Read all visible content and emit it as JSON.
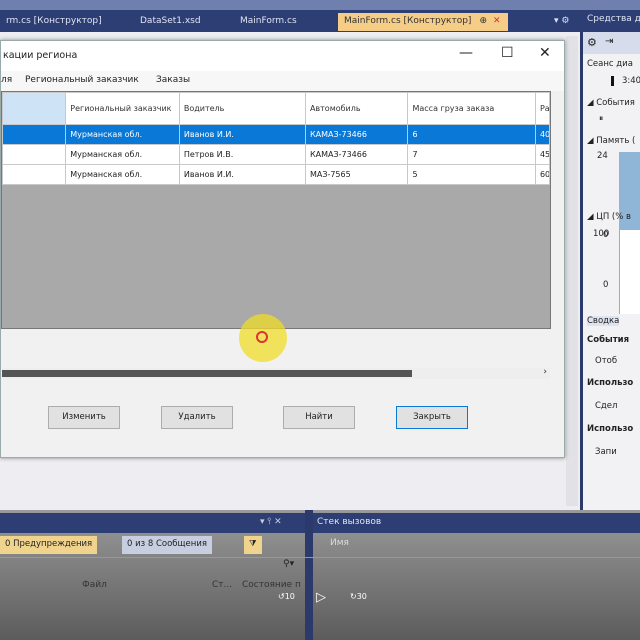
{
  "tabs": [
    {
      "label": "rm.cs [Конструктор]"
    },
    {
      "label": "DataSet1.xsd"
    },
    {
      "label": "MainForm.cs"
    },
    {
      "label": "MainForm.cs [Конструктор]",
      "active": true
    }
  ],
  "form": {
    "title": "кации региона",
    "menu": [
      "ля",
      "Региональный заказчик",
      "Заказы"
    ],
    "columns": [
      "",
      "Региональный заказчик",
      "Водитель",
      "Автомобиль",
      "Масса груза заказа",
      "Ра да"
    ],
    "rows": [
      [
        "",
        "Мурманская обл.",
        "Иванов И.И.",
        "КАМАЗ-73466",
        "6",
        "40"
      ],
      [
        "",
        "Мурманская обл.",
        "Петров И.В.",
        "КАМАЗ-73466",
        "7",
        "45"
      ],
      [
        "",
        "Мурманская обл.",
        "Иванов И.И.",
        "МАЗ-7565",
        "5",
        "60"
      ]
    ],
    "buttons": {
      "edit": "Изменить",
      "delete": "Удалить",
      "find": "Найти",
      "close": "Закрыть"
    }
  },
  "diagnostics": {
    "title": "Средства д",
    "session": "Сеанс диа",
    "time": "3:40",
    "events": "◢ События",
    "memory": "◢ Память (",
    "mem_max": "24",
    "mem_min": "0",
    "cpu": "◢ ЦП (% в",
    "cpu_max": "100",
    "cpu_min": "0",
    "tab_summary": "Сводка",
    "events2": "События",
    "show": "Отоб",
    "usage1": "Использо",
    "snapshot": "Сдел",
    "usage2": "Использо",
    "record": "Запи"
  },
  "errors": {
    "warnings": "0 Предупреждения",
    "messages": "0 из 8 Сообщения",
    "col_file": "Файл",
    "col_line": "Ст...",
    "col_state": "Состояние п"
  },
  "callstack": {
    "title": "Стек вызовов",
    "col_name": "Имя"
  },
  "player": {
    "rewind": "10",
    "forward": "30"
  }
}
